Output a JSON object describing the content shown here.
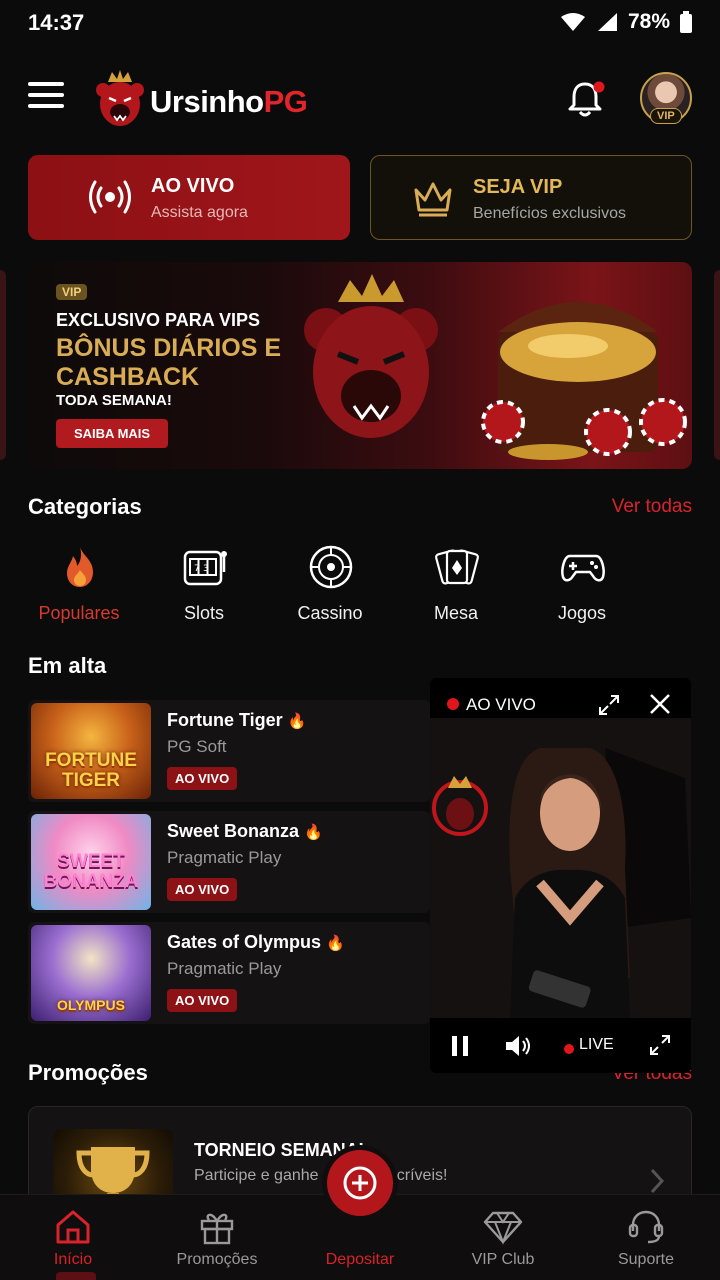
{
  "status_bar": {
    "time": "14:37",
    "battery": "78%"
  },
  "header": {
    "logo_main": "Ursinho",
    "logo_accent": "PG",
    "vip_badge": "VIP"
  },
  "quick_actions": {
    "live": {
      "title": "AO VIVO",
      "subtitle": "Assista agora"
    },
    "vip": {
      "title": "SEJA VIP",
      "subtitle": "Benefícios exclusivos"
    }
  },
  "banner": {
    "tag": "VIP",
    "line1": "EXCLUSIVO PARA VIPS",
    "line2": "BÔNUS DIÁRIOS E CASHBACK",
    "line3": "TODA SEMANA!",
    "cta": "SAIBA MAIS"
  },
  "categories": {
    "title": "Categorias",
    "see_all": "Ver todas",
    "items": [
      {
        "label": "Populares",
        "icon": "fire-icon"
      },
      {
        "label": "Slots",
        "icon": "slot-machine-icon"
      },
      {
        "label": "Cassino",
        "icon": "roulette-icon"
      },
      {
        "label": "Mesa",
        "icon": "cards-icon"
      },
      {
        "label": "Jogos",
        "icon": "gamepad-icon"
      }
    ]
  },
  "trending": {
    "title": "Em alta",
    "games": [
      {
        "name": "Fortune Tiger",
        "provider": "PG Soft",
        "badge": "AO VIVO",
        "thumb_text": "FORTUNE TIGER"
      },
      {
        "name": "Sweet Bonanza",
        "provider": "Pragmatic Play",
        "badge": "AO VIVO",
        "thumb_text": "SWEET BONANZA"
      },
      {
        "name": "Gates of Olympus",
        "provider": "Pragmatic Play",
        "badge": "AO VIVO",
        "thumb_text": "OLYMPUS"
      }
    ]
  },
  "live_player": {
    "label": "AO VIVO",
    "live": "LIVE"
  },
  "promotions": {
    "title": "Promoções",
    "see_all": "Ver todas",
    "card": {
      "title": "TORNEIO SEMANAL",
      "subtitle": "Participe e ganhe prêmios incríveis!"
    }
  },
  "bottom_nav": {
    "items": [
      {
        "label": "Início",
        "icon": "home-icon"
      },
      {
        "label": "Promoções",
        "icon": "gift-icon"
      },
      {
        "label": "Depositar",
        "icon": "plus-circle-icon"
      },
      {
        "label": "VIP Club",
        "icon": "diamond-icon"
      },
      {
        "label": "Suporte",
        "icon": "headset-icon"
      }
    ]
  },
  "colors": {
    "accent": "#d8232a",
    "gold": "#d9ad55",
    "background": "#0b0b0c"
  }
}
